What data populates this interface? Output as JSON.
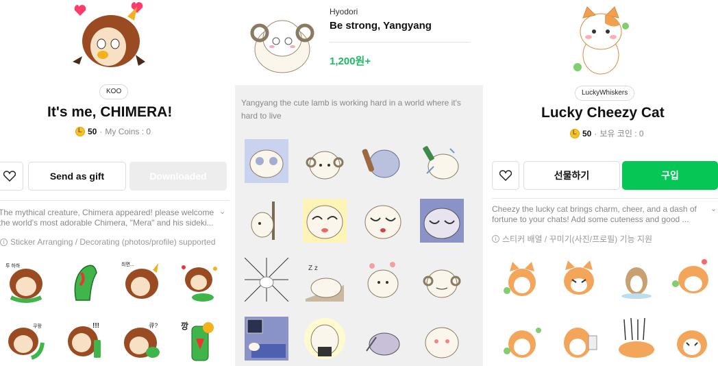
{
  "left": {
    "author": "KOO",
    "title": "It's me, CHIMERA!",
    "coin_amount": "50",
    "coin_label": "My Coins : 0",
    "gift_label": "Send as gift",
    "download_label": "Downloaded",
    "description_line1": "The mythical creature, Chimera appeared! please welcome",
    "description_line2": "the world's most adorable Chimera, \"Mera\" and his sideki...",
    "support_text": "Sticker Arranging / Decorating (photos/profile) supported",
    "sticker_texts": [
      "투 하하",
      "최면...",
      "쿠팡",
      "!!!",
      "큐?",
      "깡"
    ]
  },
  "middle": {
    "author": "Hyodori",
    "title": "Be strong, Yangyang",
    "price": "1,200원+",
    "description": "Yangyang  the cute lamb is working hard in a world where it's hard to live"
  },
  "right": {
    "author": "LuckyWhiskers",
    "title": "Lucky Cheezy Cat",
    "coin_amount": "50",
    "coin_label": "보유 코인 : 0",
    "gift_label": "선물하기",
    "buy_label": "구입",
    "description_line1": "Cheezy the lucky cat brings charm, cheer, and a dash of",
    "description_line2": "fortune to your chats! Add some cuteness and good ...",
    "support_text": "스티커 배열 / 꾸미기(사진/프로필) 기능 지원"
  },
  "colors": {
    "green": "#06c755",
    "price_green": "#1db964",
    "coin": "#f6c12b",
    "gray_bg": "#f0f0f0"
  }
}
